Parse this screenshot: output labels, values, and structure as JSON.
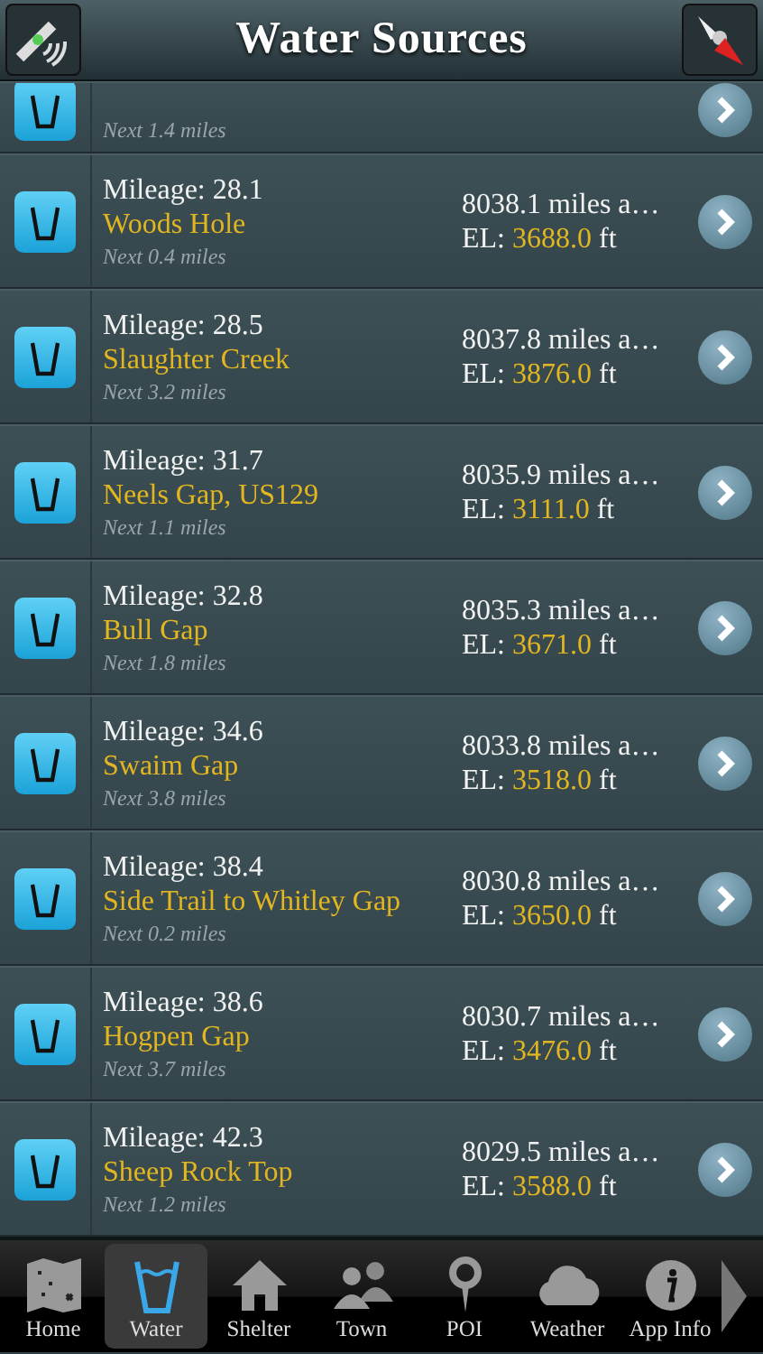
{
  "header": {
    "title": "Water Sources"
  },
  "sources": [
    {
      "kind": "partial",
      "next": "Next 1.4 miles"
    },
    {
      "kind": "full",
      "mileage": "Mileage: 28.1",
      "name": "Woods Hole",
      "next": "Next 0.4 miles",
      "distance": "8038.1 miles a…",
      "el_label": "EL:",
      "elevation": "3688.0",
      "unit": "ft"
    },
    {
      "kind": "full",
      "mileage": "Mileage: 28.5",
      "name": "Slaughter Creek",
      "next": "Next 3.2 miles",
      "distance": "8037.8 miles a…",
      "el_label": "EL:",
      "elevation": "3876.0",
      "unit": "ft"
    },
    {
      "kind": "full",
      "mileage": "Mileage: 31.7",
      "name": "Neels Gap, US129",
      "next": "Next 1.1 miles",
      "distance": "8035.9 miles a…",
      "el_label": "EL:",
      "elevation": "3111.0",
      "unit": "ft"
    },
    {
      "kind": "full",
      "mileage": "Mileage: 32.8",
      "name": "Bull Gap",
      "next": "Next 1.8 miles",
      "distance": "8035.3 miles a…",
      "el_label": "EL:",
      "elevation": "3671.0",
      "unit": "ft"
    },
    {
      "kind": "full",
      "mileage": "Mileage: 34.6",
      "name": "Swaim Gap",
      "next": "Next 3.8 miles",
      "distance": "8033.8 miles a…",
      "el_label": "EL:",
      "elevation": "3518.0",
      "unit": "ft"
    },
    {
      "kind": "full",
      "mileage": "Mileage: 38.4",
      "name": "Side Trail to Whitley Gap",
      "next": "Next 0.2 miles",
      "distance": "8030.8 miles a…",
      "el_label": "EL:",
      "elevation": "3650.0",
      "unit": "ft"
    },
    {
      "kind": "full",
      "mileage": "Mileage: 38.6",
      "name": "Hogpen Gap",
      "next": "Next 3.7 miles",
      "distance": "8030.7 miles a…",
      "el_label": "EL:",
      "elevation": "3476.0",
      "unit": "ft"
    },
    {
      "kind": "full",
      "mileage": "Mileage: 42.3",
      "name": "Sheep Rock Top",
      "next": "Next 1.2 miles",
      "distance": "8029.5 miles a…",
      "el_label": "EL:",
      "elevation": "3588.0",
      "unit": "ft"
    }
  ],
  "tabs": [
    {
      "kind": "map",
      "label": "Home",
      "selected": false
    },
    {
      "kind": "water",
      "label": "Water",
      "selected": true
    },
    {
      "kind": "house",
      "label": "Shelter",
      "selected": false
    },
    {
      "kind": "people",
      "label": "Town",
      "selected": false
    },
    {
      "kind": "pin",
      "label": "POI",
      "selected": false
    },
    {
      "kind": "cloud",
      "label": "Weather",
      "selected": false
    },
    {
      "kind": "info",
      "label": "App Info",
      "selected": false
    }
  ]
}
